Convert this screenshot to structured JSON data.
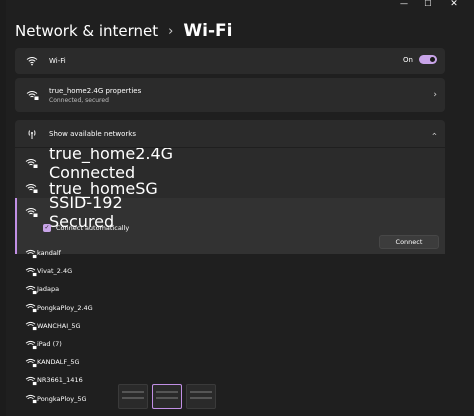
{
  "window": {
    "minimize_glyph": "—",
    "maximize_glyph": "☐",
    "close_glyph": "✕"
  },
  "breadcrumb": {
    "parent": "Network & internet",
    "separator": "›",
    "current": "Wi-Fi"
  },
  "wifi_toggle": {
    "label": "Wi-Fi",
    "state_text": "On",
    "icon": "wifi-icon",
    "accent": "#c8a4e8"
  },
  "properties": {
    "title": "true_home2.4G properties",
    "subtitle": "Connected, secured",
    "icon": "wifi-secured-icon"
  },
  "networks": {
    "header_label": "Show available networks",
    "header_icon": "antenna-icon",
    "items_top": [
      {
        "name": "true_home2.4G",
        "status": "Connected"
      },
      {
        "name": "true_homeSG",
        "status": ""
      }
    ],
    "expanded": {
      "name": "SSID-192",
      "status": "Secured",
      "auto_connect_label": "Connect automatically",
      "auto_connect_checked": true,
      "connect_label": "Connect"
    },
    "items_more": [
      {
        "name": "kandalf"
      },
      {
        "name": "Vivat_2.4G"
      },
      {
        "name": "Jadapa"
      },
      {
        "name": "PongkaPloy_2.4G"
      },
      {
        "name": "WANCHAI_5G"
      },
      {
        "name": "iPad (7)"
      },
      {
        "name": "KANDALF_5G"
      },
      {
        "name": "NR3661_1416"
      },
      {
        "name": "PongkaPloy_5G"
      }
    ]
  },
  "colors": {
    "background": "#1f1f1f",
    "card": "#2b2b2b",
    "accent": "#c18fe5"
  }
}
